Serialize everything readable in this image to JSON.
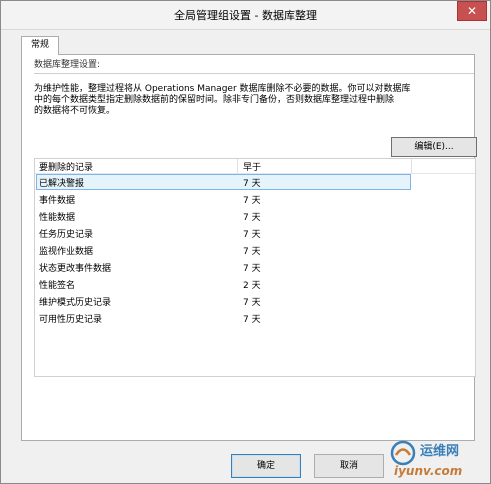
{
  "window": {
    "title": "全局管理组设置 - 数据库整理",
    "close_glyph": "✕"
  },
  "tabs": [
    {
      "label": "常规",
      "selected": true
    }
  ],
  "section": {
    "label": "数据库整理设置:",
    "description_lines": [
      "为维护性能，整理过程将从 Operations Manager 数据库删除不必要的数据。你可以对数据库",
      "中的每个数据类型指定删除数据前的保留时间。除非专门备份，否则数据库整理过程中删除",
      "的数据将不可恢复。"
    ]
  },
  "edit_button": {
    "label": "编辑(E)..."
  },
  "list": {
    "columns": [
      "要删除的记录",
      "早于"
    ],
    "selected_index": 0,
    "rows": [
      {
        "record": "已解决警报",
        "older_than": "7 天"
      },
      {
        "record": "事件数据",
        "older_than": "7 天"
      },
      {
        "record": "性能数据",
        "older_than": "7 天"
      },
      {
        "record": "任务历史记录",
        "older_than": "7 天"
      },
      {
        "record": "监视作业数据",
        "older_than": "7 天"
      },
      {
        "record": "状态更改事件数据",
        "older_than": "7 天"
      },
      {
        "record": "性能签名",
        "older_than": "2 天"
      },
      {
        "record": "维护模式历史记录",
        "older_than": "7 天"
      },
      {
        "record": "可用性历史记录",
        "older_than": "7 天"
      }
    ]
  },
  "footer": {
    "ok_label": "确定",
    "cancel_label": "取消"
  },
  "watermark": {
    "text_cn": "运维网",
    "text_url": "iyunv.com",
    "colors": {
      "blue": "#3a7fb8",
      "orange": "#c47b39"
    }
  }
}
